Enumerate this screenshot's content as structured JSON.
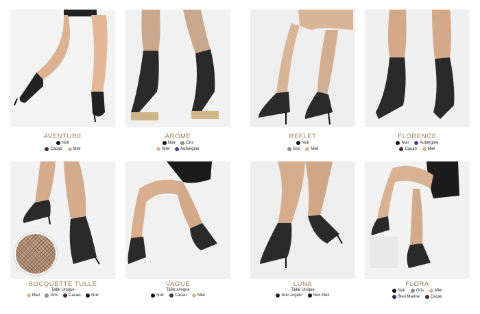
{
  "colors": {
    "title": "#9c7b4f",
    "Noir": "#111111",
    "Cacao": "#4a2f22",
    "Miel": "#d8b89a",
    "Gris": "#8e8e8e",
    "Aubergine": "#5b3b8c",
    "Noir-Argent": "#222222",
    "Noir-Noir": "#111111",
    "Bleu Marine": "#1f2d5a"
  },
  "products": [
    {
      "name": "AVENTURE",
      "sub": "",
      "rows": [
        [
          "Noir"
        ],
        [
          "Cacao",
          "Miel"
        ]
      ]
    },
    {
      "name": "AROME",
      "sub": "",
      "rows": [
        [
          "Noir",
          "Gris"
        ],
        [
          "Miel",
          "Aubergine"
        ]
      ]
    },
    {
      "name": "REFLET",
      "sub": "",
      "rows": [
        [
          "Noir"
        ],
        [
          "Gris",
          "Miel"
        ]
      ]
    },
    {
      "name": "FLORENCE",
      "sub": "",
      "rows": [
        [
          "Noir",
          "Aubergine"
        ],
        [
          "Cacao",
          "Miel"
        ]
      ]
    },
    {
      "name": "SOCQUETTE TULLE",
      "sub": "Taille Unique",
      "rows": [
        [
          "Miel",
          "Gris",
          "Cacao",
          "Noir"
        ]
      ]
    },
    {
      "name": "VAGUE",
      "sub": "Taille Unique",
      "rows": [
        [
          "Noir",
          "Cacao",
          "Miel"
        ]
      ]
    },
    {
      "name": "LUNA",
      "sub": "Taille Unique",
      "rows": [
        [
          "Noir-Argent",
          "Noir-Noir"
        ]
      ]
    },
    {
      "name": "FLORA",
      "sub": "",
      "rows": [
        [
          "Noir",
          "Gris",
          "Miel"
        ],
        [
          "Bleu Marine",
          "Cacao"
        ]
      ]
    }
  ]
}
